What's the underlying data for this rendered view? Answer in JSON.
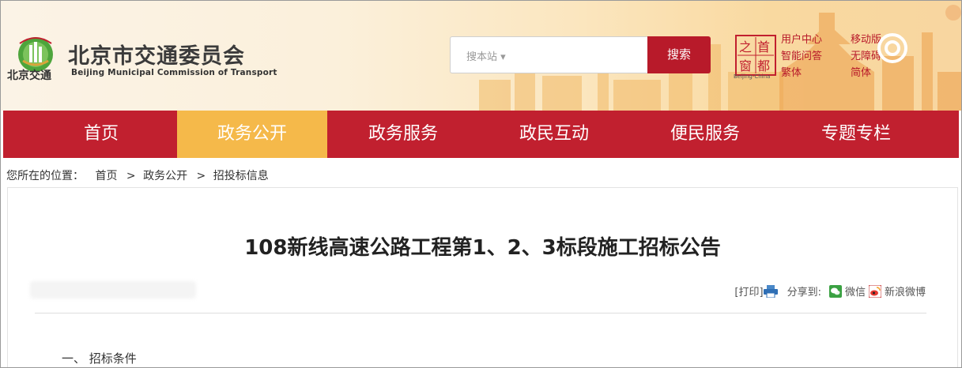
{
  "header": {
    "logo_small_cn": "北京交通",
    "site_name_cn": "北京市交通委员会",
    "site_name_en": "Beijing Municipal Commission of Transport",
    "search_placeholder": "搜本站 ▾",
    "search_button": "搜索",
    "seal_chars": [
      "首",
      "都",
      "之",
      "窗"
    ],
    "seal_caption": "Beijing-China",
    "quick_links": [
      "用户中心",
      "移动版",
      "智能问答",
      "无障碍",
      "繁体",
      "简体"
    ]
  },
  "nav": {
    "items": [
      {
        "label": "首页"
      },
      {
        "label": "政务公开"
      },
      {
        "label": "政务服务"
      },
      {
        "label": "政民互动"
      },
      {
        "label": "便民服务"
      },
      {
        "label": "专题专栏"
      }
    ],
    "active_index": 1
  },
  "breadcrumb": {
    "prefix": "您所在的位置：",
    "items": [
      "首页",
      "政务公开",
      "招投标信息"
    ],
    "separator": ">"
  },
  "article": {
    "title": "108新线高速公路工程第1、2、3标段施工招标公告",
    "print_label": "[打印]",
    "share_label": "分享到:",
    "share_wechat": "微信",
    "share_weibo": "新浪微博",
    "section_1": "一、 招标条件"
  },
  "colors": {
    "brand_red": "#c1202f",
    "active_tab": "#f5b94a",
    "search_button": "#b81a2a"
  }
}
